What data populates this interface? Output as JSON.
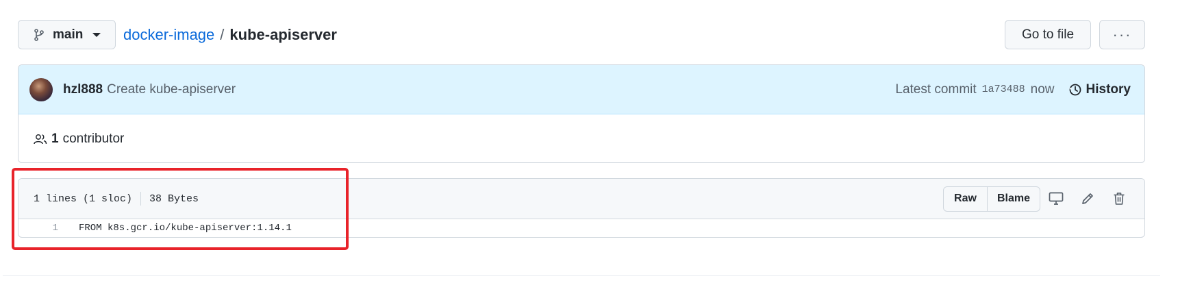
{
  "branch": {
    "name": "main",
    "icon": "git-branch-icon"
  },
  "breadcrumb": {
    "repo": "docker-image",
    "separator": "/",
    "file": "kube-apiserver"
  },
  "top_actions": {
    "goto_label": "Go to file",
    "more_label": "···"
  },
  "commit": {
    "author": "hzl888",
    "message": "Create kube-apiserver",
    "latest_label": "Latest commit",
    "sha": "1a73488",
    "time": "now",
    "history_label": "History"
  },
  "contributors": {
    "count": "1",
    "label": "contributor"
  },
  "file": {
    "lines_info": "1 lines (1 sloc)",
    "size": "38 Bytes",
    "raw_label": "Raw",
    "blame_label": "Blame",
    "code": [
      {
        "num": "1",
        "text": "FROM k8s.gcr.io/kube-apiserver:1.14.1"
      }
    ]
  },
  "colors": {
    "link": "#0969da",
    "commit_bg": "#ddf4ff",
    "highlight": "#e8232a"
  }
}
